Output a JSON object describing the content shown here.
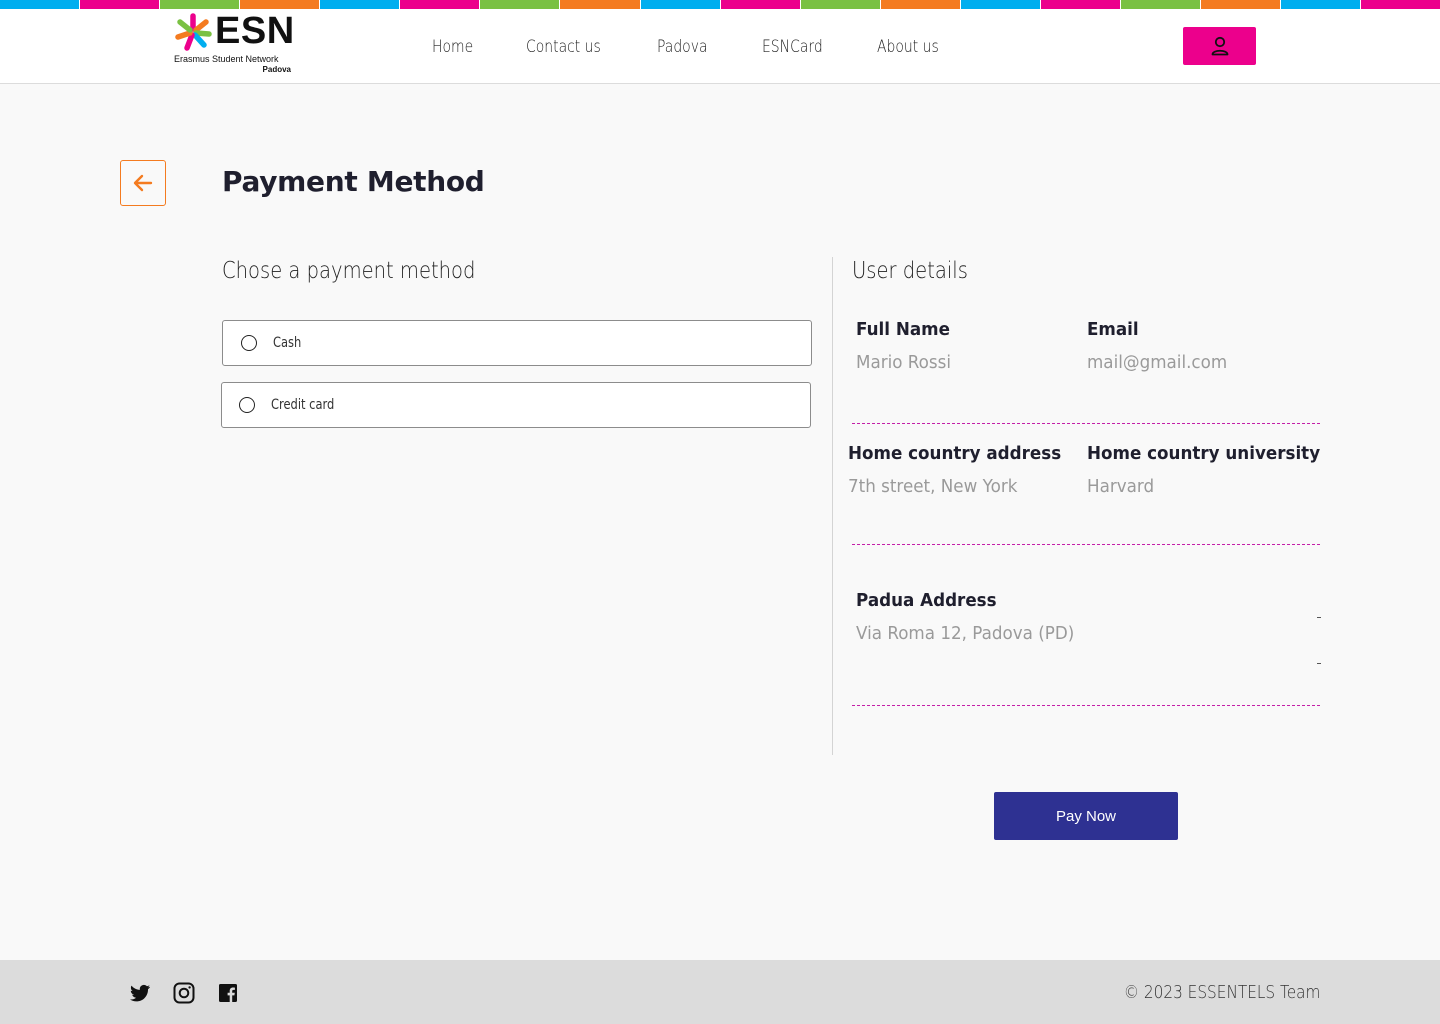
{
  "stripe_colors": [
    "#00aeef",
    "#ec008c",
    "#7ac143",
    "#f47b20",
    "#00aeef",
    "#ec008c",
    "#7ac143",
    "#f47b20",
    "#00aeef",
    "#ec008c",
    "#7ac143",
    "#f47b20",
    "#00aeef",
    "#ec008c",
    "#7ac143",
    "#f47b20",
    "#00aeef",
    "#ec008c"
  ],
  "header": {
    "logo_text": "ESN",
    "logo_subtitle": "Erasmus Student Network",
    "logo_city": "Padova",
    "nav": [
      "Home",
      "Contact us",
      "Padova",
      "ESNCard",
      "About us"
    ],
    "user_icon": "user-icon"
  },
  "page": {
    "title": "Payment Method",
    "back_icon": "arrow-left-icon"
  },
  "payment": {
    "heading": "Chose a payment method",
    "options": [
      "Cash",
      "Credit card"
    ]
  },
  "user_details": {
    "heading": "User details",
    "full_name_label": "Full Name",
    "full_name_value": "Mario Rossi",
    "email_label": "Email",
    "email_value": "mail@gmail.com",
    "home_address_label": "Home country address",
    "home_address_value": "7th street, New York",
    "home_university_label": "Home country university",
    "home_university_value": "Harvard",
    "padua_address_label": "Padua Address",
    "padua_address_value": "Via Roma 12, Padova (PD)"
  },
  "actions": {
    "pay_now": "Pay Now"
  },
  "footer": {
    "social_icons": [
      "twitter-icon",
      "instagram-icon",
      "facebook-icon"
    ],
    "copyright": "© 2023 ESSENTELS Team"
  },
  "colors": {
    "accent_pink": "#ec008c",
    "accent_orange": "#f47b20",
    "primary_button": "#2e3192",
    "divider_dash": "#c41fa8"
  }
}
